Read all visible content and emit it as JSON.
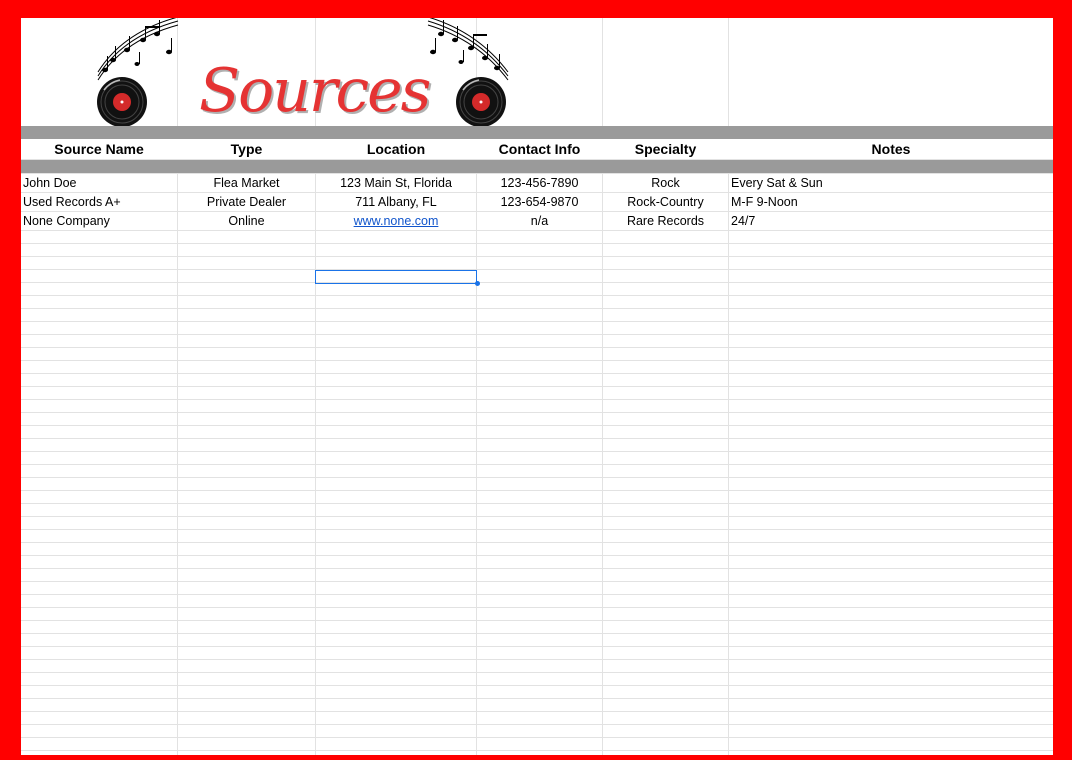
{
  "sheet": {
    "title": "Sources",
    "columns": [
      "Source Name",
      "Type",
      "Location",
      "Contact Info",
      "Specialty",
      "Notes"
    ],
    "rows": [
      {
        "name": "John Doe",
        "type": "Flea Market",
        "location": "123 Main St, Florida",
        "contact": "123-456-7890",
        "specialty": "Rock",
        "notes": "Every Sat & Sun"
      },
      {
        "name": "Used Records A+",
        "type": "Private Dealer",
        "location": "711 Albany, FL",
        "contact": "123-654-9870",
        "specialty": "Rock-Country",
        "notes": "M-F 9-Noon"
      },
      {
        "name": "None Company",
        "type": "Online",
        "location": "www.none.com ",
        "contact": "n/a",
        "specialty": "Rare Records",
        "notes": "24/7"
      }
    ]
  },
  "theme": {
    "frame_color": "#ff0000",
    "title_color": "#e53333",
    "band_color": "#9a9a9a",
    "link_color": "#1155cc",
    "selection_color": "#1a73e8"
  },
  "icons": [
    "vinyl-record-icon",
    "music-notes-icon"
  ]
}
